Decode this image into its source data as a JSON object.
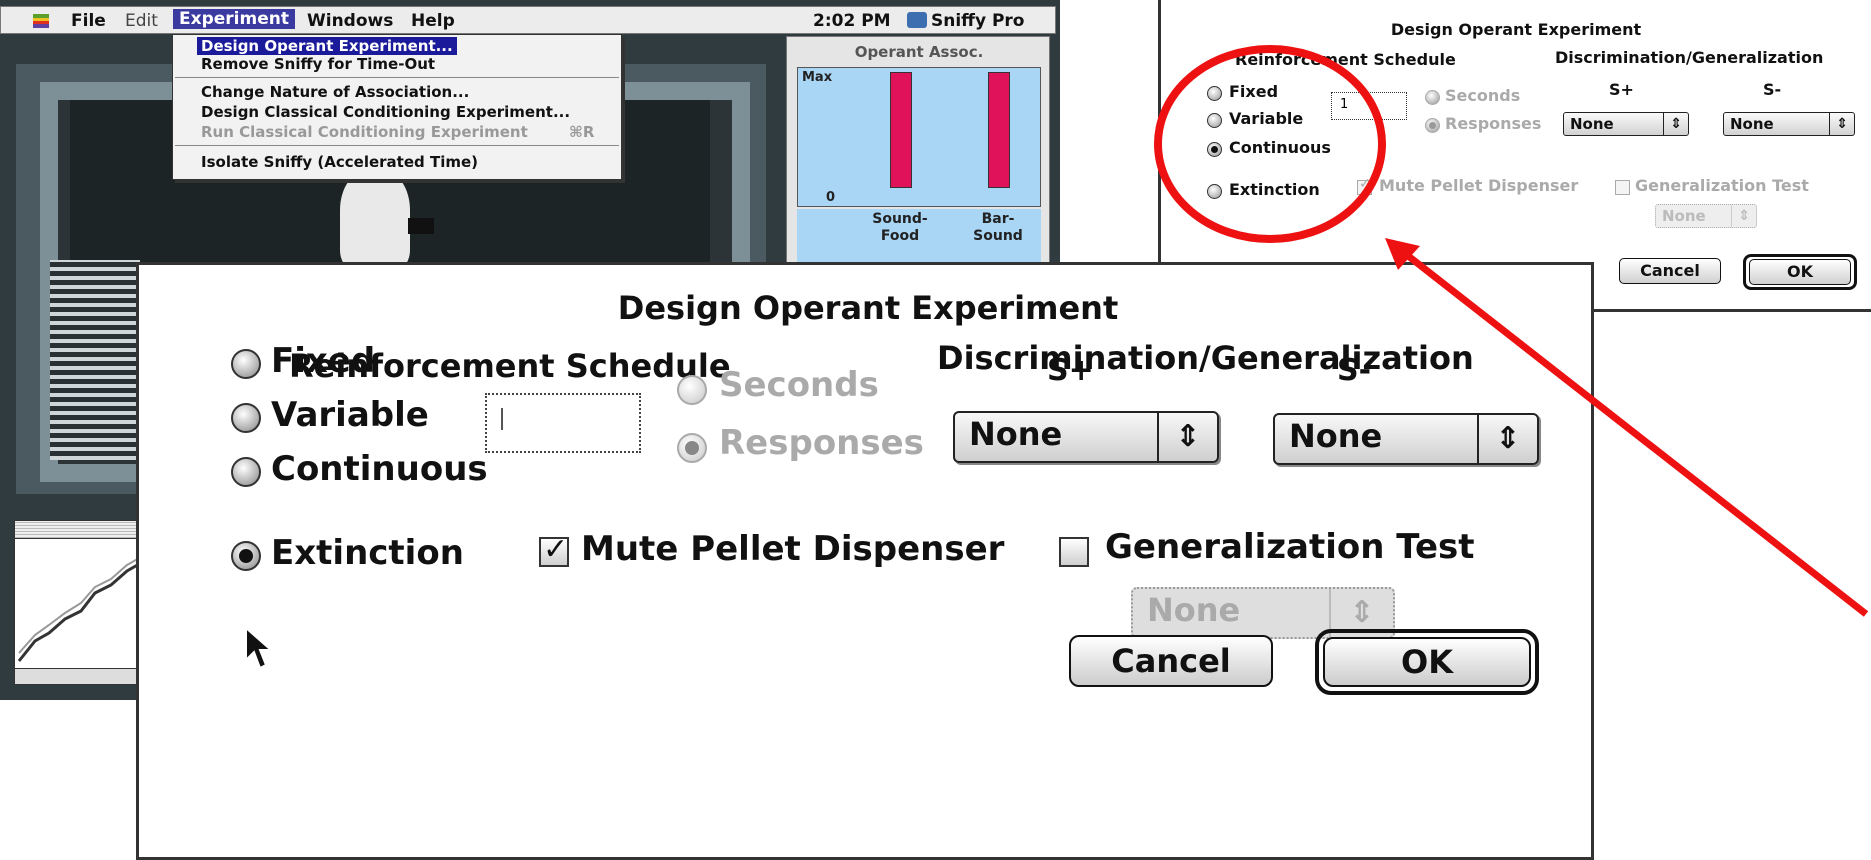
{
  "menubar": {
    "apple_icon": "apple-icon",
    "items": [
      "File",
      "Edit",
      "Experiment",
      "Windows",
      "Help"
    ],
    "clock": "2:02 PM",
    "app_name": "Sniffy Pro"
  },
  "experiment_menu": {
    "items": [
      {
        "label": "Design Operant Experiment...",
        "state": "highlighted"
      },
      {
        "label": "Remove Sniffy for Time-Out",
        "state": "enabled"
      },
      {
        "label": "Change Nature of Association...",
        "state": "enabled"
      },
      {
        "label": "Design Classical Conditioning Experiment...",
        "state": "enabled"
      },
      {
        "label": "Run Classical Conditioning Experiment",
        "state": "disabled"
      },
      {
        "label": "Isolate Sniffy (Accelerated Time)",
        "state": "enabled"
      }
    ],
    "shortcut": "⌘R"
  },
  "operant_assoc": {
    "title": "Operant Assoc.",
    "axis_max": "Max",
    "axis_zero": "0",
    "bars": [
      {
        "label_line1": "Sound-",
        "label_line2": "Food",
        "level": 1.0
      },
      {
        "label_line1": "Bar-",
        "label_line2": "Sound",
        "level": 1.0
      }
    ],
    "bar_color": "#e0125a"
  },
  "dialog": {
    "title": "Design Operant Experiment",
    "reinforcement_schedule_label": "Reinforcement Schedule",
    "discrimination_label": "Discrimination/Generalization",
    "schedule_options": [
      {
        "label": "Fixed",
        "selected": false
      },
      {
        "label": "Variable",
        "selected": false
      },
      {
        "label": "Continuous",
        "selected": false
      }
    ],
    "extinction": {
      "label": "Extinction",
      "selected": true
    },
    "value_field": "",
    "unit_options": [
      {
        "label": "Seconds",
        "selected": false,
        "disabled": true
      },
      {
        "label": "Responses",
        "selected": true,
        "disabled": true
      }
    ],
    "s_plus_label": "S+",
    "s_minus_label": "S-",
    "s_plus_value": "None",
    "s_minus_value": "None",
    "mute_pellet": {
      "label": "Mute Pellet Dispenser",
      "checked": true
    },
    "generalization_test": {
      "label": "Generalization Test",
      "checked": false
    },
    "generalization_value": "None",
    "cancel_label": "Cancel",
    "ok_label": "OK"
  },
  "small_dialog": {
    "title": "Design Operant Experiment",
    "reinforcement_schedule_label": "Reinforcement Schedule",
    "discrimination_label": "Discrimination/Generalization",
    "schedule_options": [
      {
        "label": "Fixed",
        "selected": false
      },
      {
        "label": "Variable",
        "selected": false
      },
      {
        "label": "Continuous",
        "selected": true
      }
    ],
    "extinction": {
      "label": "Extinction",
      "selected": false
    },
    "value_field": "1",
    "unit_options": [
      {
        "label": "Seconds",
        "selected": false,
        "disabled": true
      },
      {
        "label": "Responses",
        "selected": true,
        "disabled": true
      }
    ],
    "s_plus_label": "S+",
    "s_minus_label": "S-",
    "s_plus_value": "None",
    "s_minus_value": "None",
    "mute_pellet": {
      "label": "Mute Pellet Dispenser",
      "checked": true,
      "disabled": true
    },
    "generalization_test": {
      "label": "Generalization Test",
      "checked": false,
      "disabled": true
    },
    "generalization_value": "None",
    "cancel_label": "Cancel",
    "ok_label": "OK"
  },
  "annotation_color": "#ee1111",
  "icons": {
    "cursor": "arrow-cursor-icon",
    "popup_arrows": "up-down-arrows-icon",
    "checkmark": "checkmark-icon"
  }
}
